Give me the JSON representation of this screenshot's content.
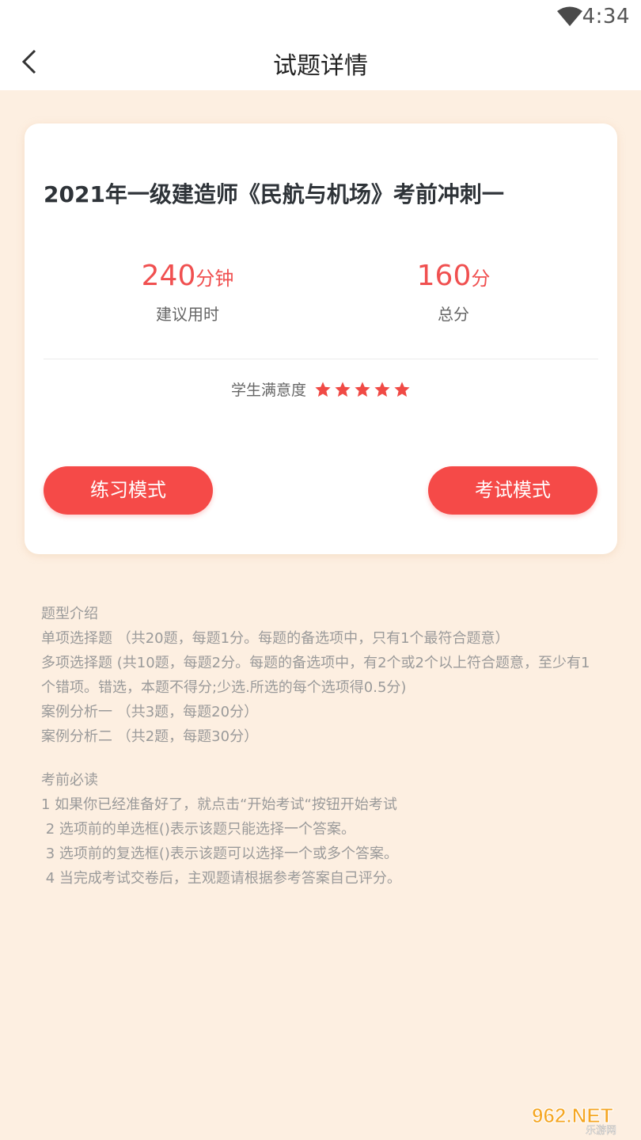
{
  "status_bar": {
    "time": "4:34",
    "wifi_icon": "wifi-icon"
  },
  "header": {
    "title": "试题详情",
    "back_icon": "chevron-left-icon"
  },
  "card": {
    "exam_title": "2021年一级建造师《民航与机场》考前冲刺一",
    "suggested_time": {
      "value": "240",
      "unit": "分钟",
      "label": "建议用时"
    },
    "total_score": {
      "value": "160",
      "unit": "分",
      "label": "总分"
    },
    "satisfaction": {
      "label": "学生满意度",
      "stars": 5,
      "max_stars": 5
    },
    "practice_button": "练习模式",
    "exam_button": "考试模式"
  },
  "question_types": {
    "title": "题型介绍",
    "items": [
      "单项选择题 （共20题，每题1分。每题的备选项中，只有1个最符合题意）",
      "多项选择题 (共10题，每题2分。每题的备选项中，有2个或2个以上符合题意，至少有1个错项。错选，本题不得分;少选.所选的每个选项得0.5分)",
      "案例分析一 （共3题，每题20分）",
      "案例分析二 （共2题，每题30分）"
    ]
  },
  "exam_notes": {
    "title": "考前必读",
    "items": [
      "1 如果你已经准备好了，就点击“开始考试“按钮开始考试",
      " 2 选项前的单选框()表示该题只能选择一个答案。",
      " 3 选项前的复选框()表示该题可以选择一个或多个答案。",
      " 4 当完成考试交卷后，主观题请根据参考答案自己评分。"
    ]
  },
  "watermark": {
    "text": "962.NET",
    "subtext": "乐游网"
  },
  "colors": {
    "accent": "#f54a48",
    "background": "#fdefe1",
    "star": "#f04a45"
  }
}
